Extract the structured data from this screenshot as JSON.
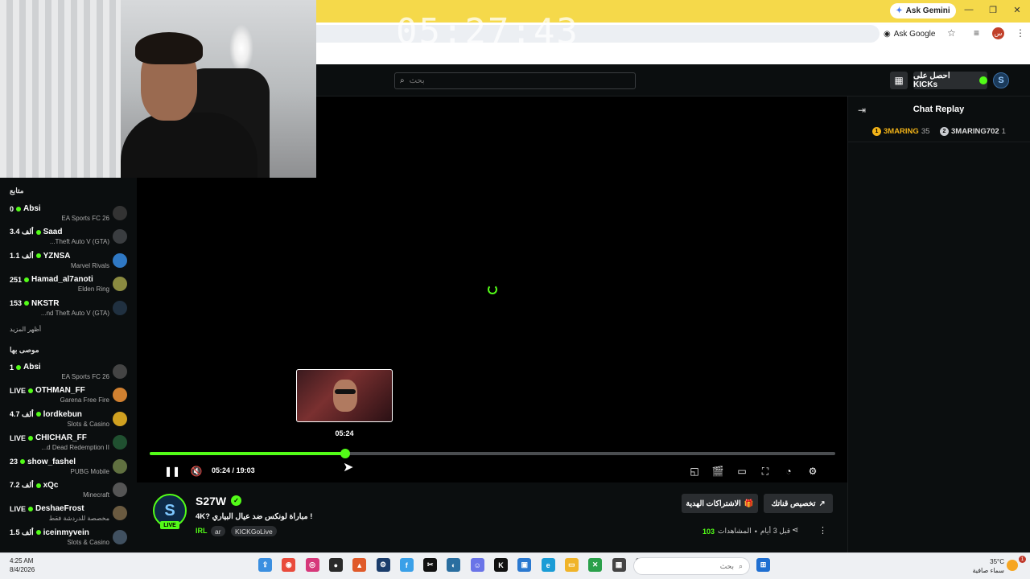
{
  "browser": {
    "ask_gemini": "Ask Gemini",
    "ask_google": "Ask Google",
    "profile_initial": "س",
    "colors": {
      "tab_bar": "#f5d94a"
    }
  },
  "overlay": {
    "clock": "05:27:43"
  },
  "header": {
    "search_placeholder": "بحث",
    "get_kicks": "احصل على KICKs"
  },
  "sidebar": {
    "following_title": "متابع",
    "following": [
      {
        "count": "0",
        "name": "Absi",
        "category": "EA Sports FC 26"
      },
      {
        "count": "3.4 ألف",
        "name": "Saad",
        "category": "...Theft Auto V (GTA)"
      },
      {
        "count": "1.1 ألف",
        "name": "YZNSA",
        "category": "Marvel Rivals"
      },
      {
        "count": "251",
        "name": "Hamad_al7anoti",
        "category": "Elden Ring"
      },
      {
        "count": "153",
        "name": "NKSTR",
        "category": "...nd Theft Auto V (GTA)"
      }
    ],
    "show_more": "أظهر المزيد",
    "recommended_title": "موصى بها",
    "recommended": [
      {
        "count": "1",
        "name": "Absi",
        "category": "EA Sports FC 26"
      },
      {
        "count": "LIVE",
        "name": "OTHMAN_FF",
        "category": "Garena Free Fire"
      },
      {
        "count": "4.7 ألف",
        "name": "lordkebun",
        "category": "Slots & Casino"
      },
      {
        "count": "LIVE",
        "name": "CHICHAR_FF",
        "category": "...d Dead Redemption II"
      },
      {
        "count": "23",
        "name": "show_fashel",
        "category": "PUBG Mobile"
      },
      {
        "count": "7.2 ألف",
        "name": "xQc",
        "category": "Minecraft"
      },
      {
        "count": "LIVE",
        "name": "DeshaeFrost",
        "category": "مخصصة للدردشة فقط"
      },
      {
        "count": "1.5 ألف",
        "name": "iceinmyvein",
        "category": "Slots & Casino"
      }
    ]
  },
  "player": {
    "preview_time": "05:24",
    "current_time": "05:24",
    "duration": "19:03",
    "time_separator": "/",
    "progress": 0.285
  },
  "chat": {
    "title": "Chat Replay",
    "top_gifters": [
      {
        "rank": "1",
        "name": "3MARING",
        "count": "35"
      },
      {
        "rank": "2",
        "name": "3MARING702",
        "count": "1"
      }
    ]
  },
  "stream": {
    "streamer": "S27W",
    "avatar_letter": "S",
    "live_badge": "LIVE",
    "title": "4K? مباراة لونكس ضد عيال البياري !",
    "category": "IRL",
    "tags": [
      "ar",
      "KICKGoLive"
    ],
    "subscriptions_button": "الاشتراكات الهدية",
    "customize_button": "تخصيص قناتك",
    "views_label": "المشاهدات",
    "views_count": "103",
    "age": "قبل 3 أيام",
    "separator": "•"
  },
  "taskbar": {
    "time": "4:25 AM",
    "date": "8/4/2026",
    "search_placeholder": "بحث",
    "temperature": "35°C",
    "weather": "سماء صافية",
    "notifications": "1"
  }
}
